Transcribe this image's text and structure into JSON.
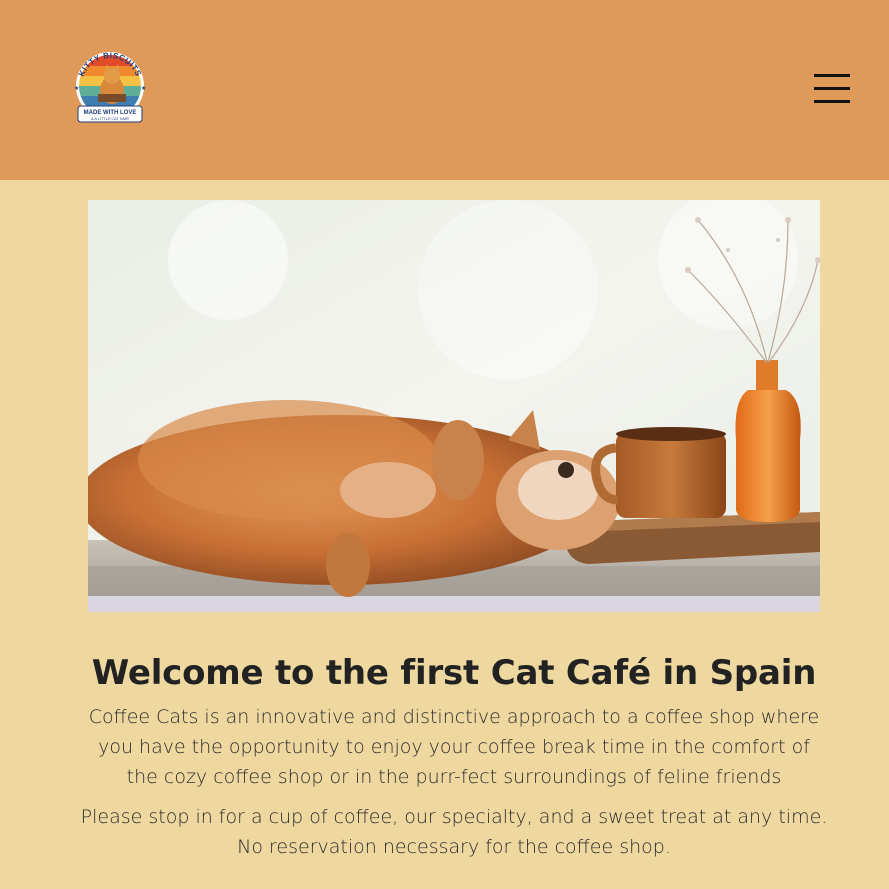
{
  "header": {
    "logo": {
      "top_text": "KITTY BISCUITS",
      "middle_text": "MADE WITH LOVE",
      "bottom_text": "& A LITTLE CAT HAIR",
      "icon": "cat-logo-icon"
    },
    "menu_icon": "hamburger-menu-icon"
  },
  "hero": {
    "icon": "cat-photo-icon"
  },
  "main": {
    "title": "Welcome to the first Cat Café in Spain",
    "paragraph1": "Coffee Cats is an innovative and distinctive approach to a coffee shop where you have the opportunity to enjoy your coffee break time in the comfort of the cozy coffee shop or in the purr-fect surroundings of feline friends",
    "paragraph2": "Please stop in for a cup of coffee, our specialty, and a sweet treat at any time. No reservation necessary for the coffee shop."
  },
  "colors": {
    "header_bg": "#df9a59",
    "page_bg": "#efd8a0",
    "text": "#2b2b2b"
  }
}
